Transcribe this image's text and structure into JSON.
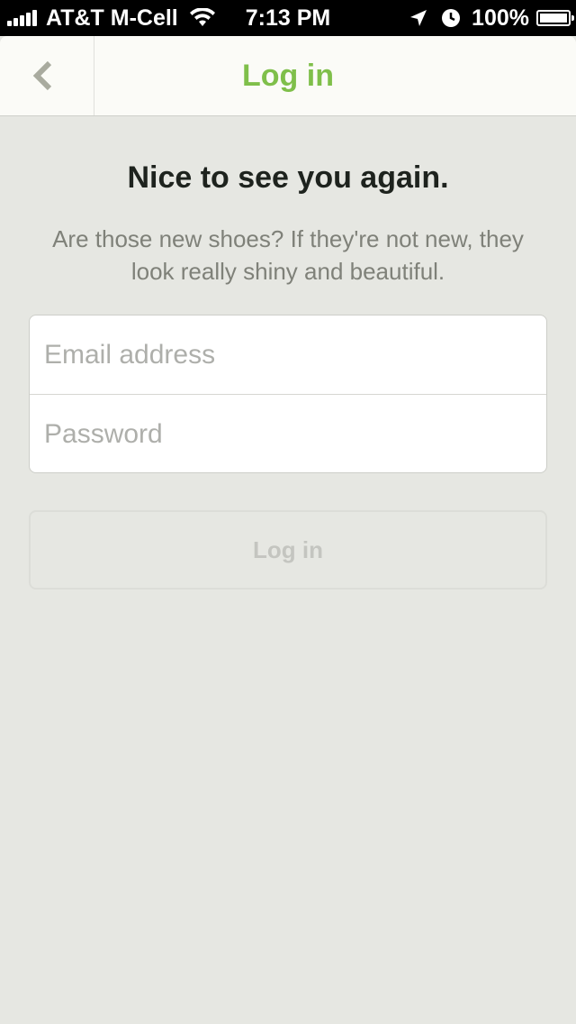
{
  "status_bar": {
    "carrier": "AT&T M-Cell",
    "time": "7:13 PM",
    "battery": "100%",
    "icons": [
      "signal-icon",
      "wifi-icon",
      "location-icon",
      "alarm-icon",
      "battery-icon"
    ]
  },
  "nav": {
    "title": "Log in",
    "back_icon": "chevron-left-icon"
  },
  "main": {
    "headline": "Nice to see you again.",
    "subtext": "Are those new shoes? If they're not new, they look really shiny and beautiful."
  },
  "form": {
    "email_placeholder": "Email address",
    "password_placeholder": "Password",
    "submit_label": "Log in"
  },
  "colors": {
    "accent": "#7fbf4a",
    "background": "#e6e7e2",
    "headline": "#1e231e",
    "muted": "#7f8179"
  }
}
